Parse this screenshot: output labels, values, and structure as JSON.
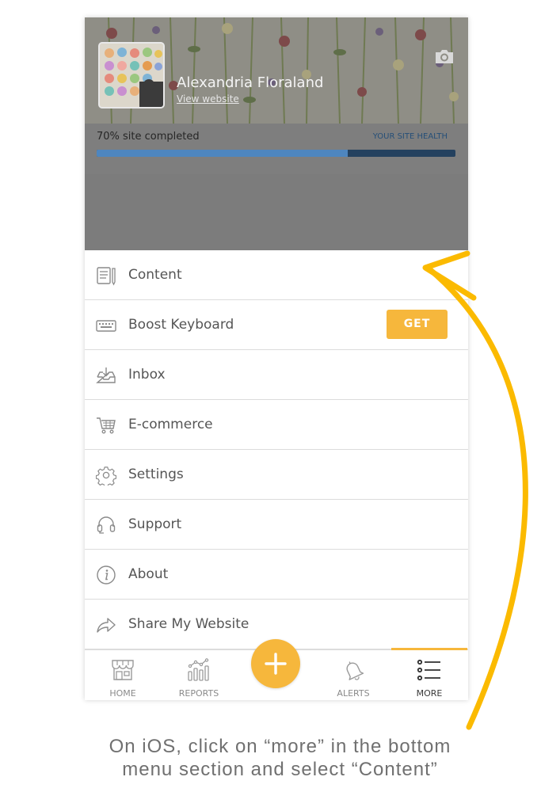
{
  "profile": {
    "name": "Alexandria Floraland",
    "view_link": "View website",
    "camera_icon": "camera-icon"
  },
  "site_health": {
    "completion_text": "70% site completed",
    "completion_percent": 70,
    "health_link": "YOUR SITE HEALTH"
  },
  "menu": {
    "items": [
      {
        "label": "Content",
        "icon": "content-icon"
      },
      {
        "label": "Boost Keyboard",
        "icon": "keyboard-icon",
        "action": "GET"
      },
      {
        "label": "Inbox",
        "icon": "inbox-icon"
      },
      {
        "label": "E-commerce",
        "icon": "cart-icon"
      },
      {
        "label": "Settings",
        "icon": "gear-icon"
      },
      {
        "label": "Support",
        "icon": "headset-icon"
      },
      {
        "label": "About",
        "icon": "info-icon"
      },
      {
        "label": "Share My Website",
        "icon": "share-icon"
      }
    ]
  },
  "tabbar": {
    "tabs": [
      {
        "label": "HOME",
        "icon": "store-icon"
      },
      {
        "label": "REPORTS",
        "icon": "reports-icon"
      },
      {
        "label": "",
        "icon": "plus-icon"
      },
      {
        "label": "ALERTS",
        "icon": "bell-icon"
      },
      {
        "label": "MORE",
        "icon": "list-icon",
        "active": true
      }
    ]
  },
  "caption": {
    "line1": "On iOS, click on “more” in the bottom",
    "line2": "menu section and select “Content”"
  },
  "colors": {
    "accent": "#f6b73c",
    "progress_fill": "#4e86bf",
    "progress_track": "#24415f",
    "overlay": "#7c7c7c"
  }
}
